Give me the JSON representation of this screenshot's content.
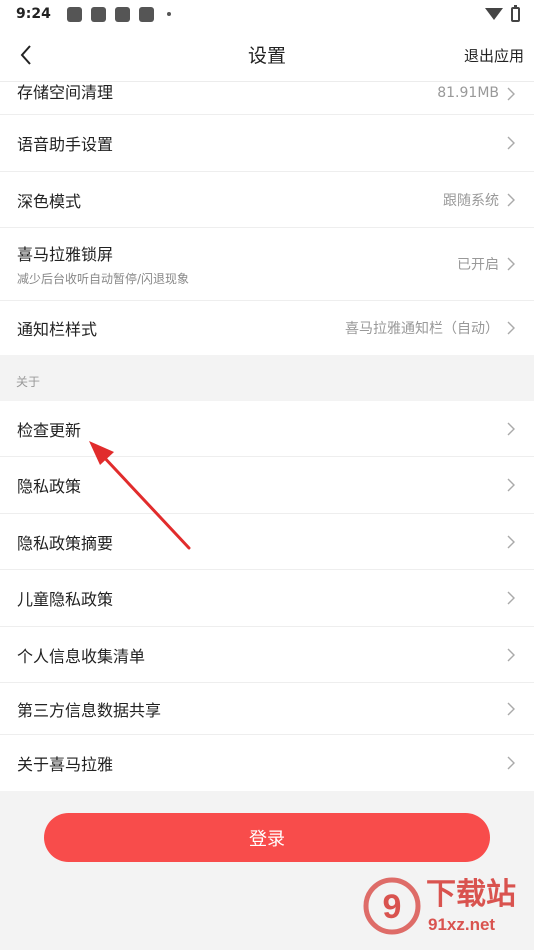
{
  "status_bar": {
    "time": "9:24"
  },
  "nav": {
    "title": "设置",
    "exit_label": "退出应用"
  },
  "settings": [
    {
      "label": "存储空间清理",
      "value": "81.91MB"
    },
    {
      "label": "语音助手设置",
      "value": ""
    },
    {
      "label": "深色模式",
      "value": "跟随系统"
    },
    {
      "label": "喜马拉雅锁屏",
      "sub": "减少后台收听自动暂停/闪退现象",
      "value": "已开启"
    },
    {
      "label": "通知栏样式",
      "value": "喜马拉雅通知栏（自动）"
    }
  ],
  "about": {
    "header": "关于",
    "items": [
      {
        "label": "检查更新"
      },
      {
        "label": "隐私政策"
      },
      {
        "label": "隐私政策摘要"
      },
      {
        "label": "儿童隐私政策"
      },
      {
        "label": "个人信息收集清单"
      },
      {
        "label": "第三方信息数据共享"
      },
      {
        "label": "关于喜马拉雅"
      }
    ]
  },
  "login": {
    "label": "登录"
  },
  "watermark": {
    "brand": "下载站",
    "domain": "91xz.net",
    "number": "9"
  },
  "colors": {
    "accent": "#f84c4b",
    "arrow": "#e12c2c",
    "watermark": "#d9534f"
  }
}
